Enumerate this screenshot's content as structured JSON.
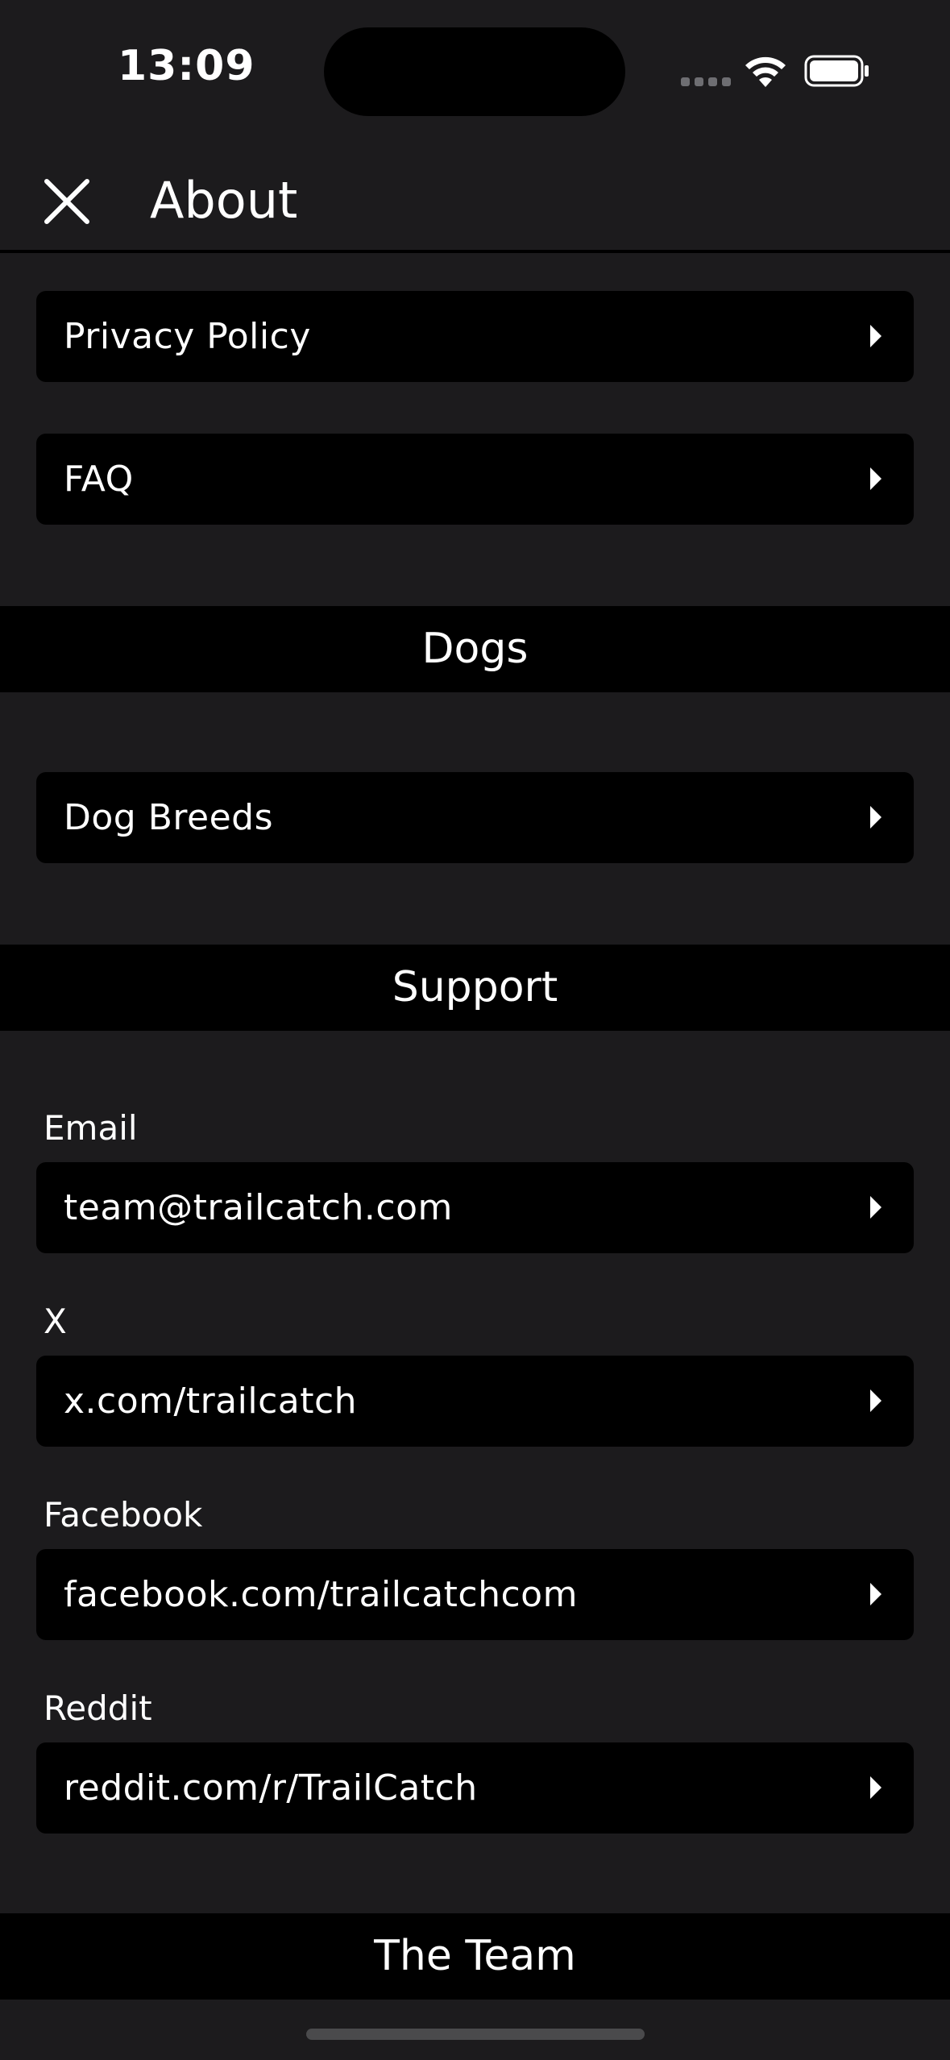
{
  "status_bar": {
    "time": "13:09"
  },
  "header": {
    "title": "About",
    "close_icon": "close-icon"
  },
  "links": {
    "privacy_policy": "Privacy Policy",
    "faq": "FAQ"
  },
  "sections": {
    "dogs": {
      "title": "Dogs",
      "dog_breeds": "Dog Breeds"
    },
    "support": {
      "title": "Support",
      "email_label": "Email",
      "email_value": "team@trailcatch.com",
      "x_label": "X",
      "x_value": "x.com/trailcatch",
      "facebook_label": "Facebook",
      "facebook_value": "facebook.com/trailcatchcom",
      "reddit_label": "Reddit",
      "reddit_value": "reddit.com/r/TrailCatch"
    },
    "team": {
      "title": "The Team"
    }
  },
  "colors": {
    "background": "#1c1b1d",
    "row_background": "#000000",
    "text": "#ffffff"
  }
}
